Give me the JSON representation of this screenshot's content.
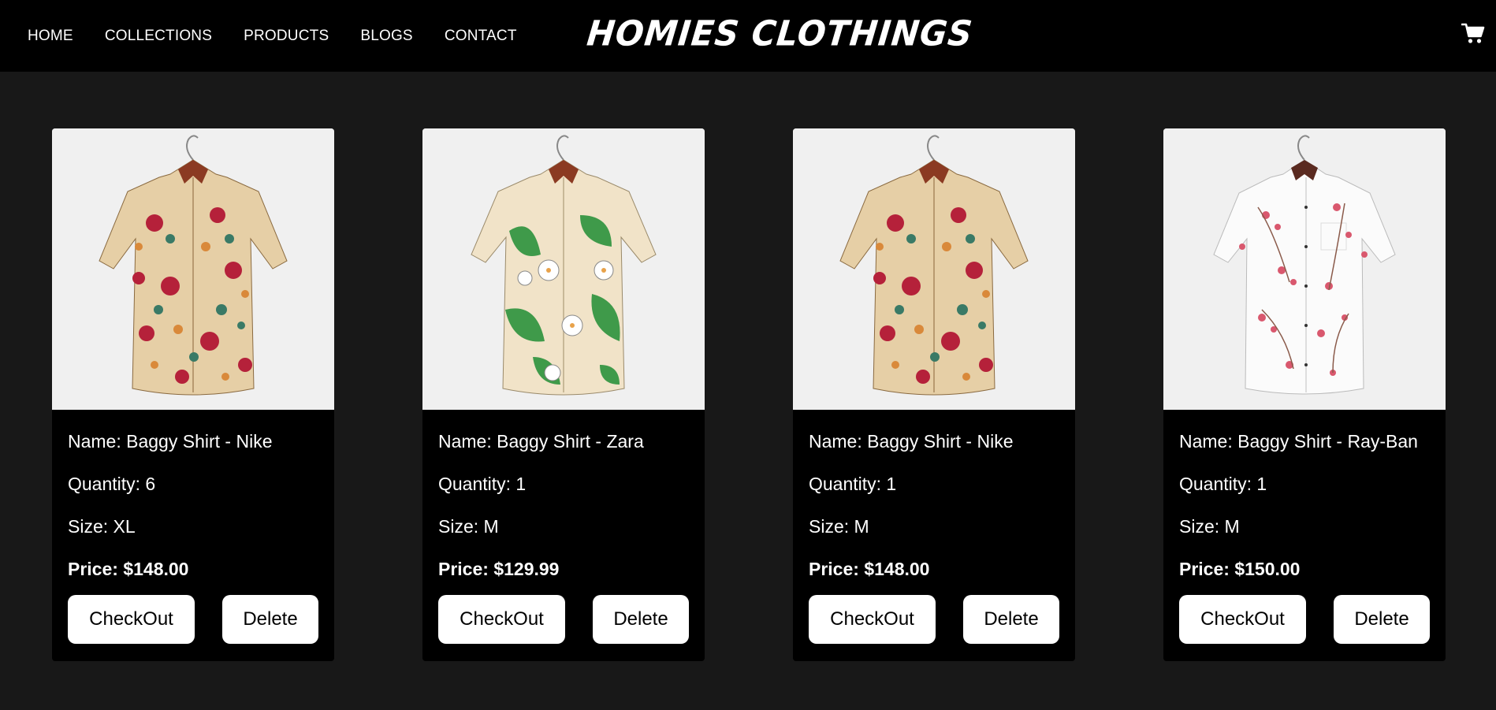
{
  "nav": {
    "links": [
      "HOME",
      "COLLECTIONS",
      "PRODUCTS",
      "BLOGS",
      "CONTACT"
    ],
    "brand": "HOMIES CLOTHINGS",
    "cart_icon": "shopping-cart-icon"
  },
  "cart_items": [
    {
      "name": "Name: Baggy Shirt - Nike",
      "quantity": "Quantity: 6",
      "size": "Size: XL",
      "price": "Price: $148.00",
      "checkout_label": "CheckOut",
      "delete_label": "Delete",
      "image": "floral-shirt-beige-red"
    },
    {
      "name": "Name: Baggy Shirt - Zara",
      "quantity": "Quantity: 1",
      "size": "Size: M",
      "price": "Price: $129.99",
      "checkout_label": "CheckOut",
      "delete_label": "Delete",
      "image": "floral-shirt-cream-green-leaves"
    },
    {
      "name": "Name: Baggy Shirt - Nike",
      "quantity": "Quantity: 1",
      "size": "Size: M",
      "price": "Price: $148.00",
      "checkout_label": "CheckOut",
      "delete_label": "Delete",
      "image": "floral-shirt-beige-red"
    },
    {
      "name": "Name: Baggy Shirt - Ray-Ban",
      "quantity": "Quantity: 1",
      "size": "Size: M",
      "price": "Price: $150.00",
      "checkout_label": "CheckOut",
      "delete_label": "Delete",
      "image": "floral-shirt-white-pink"
    }
  ],
  "colors": {
    "page_bg": "#181818",
    "navbar_bg": "#000000",
    "card_bg": "#000000",
    "button_bg": "#ffffff",
    "text": "#ffffff"
  }
}
